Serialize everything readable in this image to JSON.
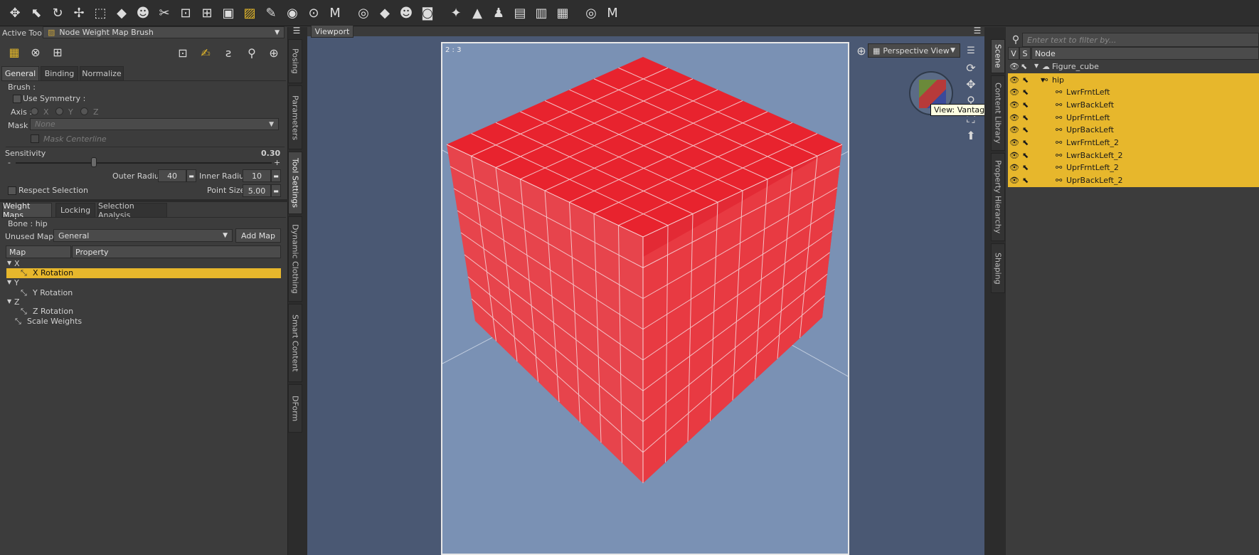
{
  "toolbar": {
    "icons": [
      "move-universal-icon",
      "pointer-icon",
      "rotate-icon",
      "translate-icon",
      "scale-icon",
      "geometry-brush-icon",
      "figure-tool-icon",
      "joint-editor-icon",
      "region-nav-icon",
      "spotlight-icon",
      "surface-selection-icon",
      "node-weight-brush-icon",
      "geometry-editor-icon",
      "node-selection-icon",
      "camera-icon",
      "morph-icon",
      "render-icon",
      "geometry-icon",
      "figure-icon",
      "camera2-icon",
      "light-icon",
      "scene-icon",
      "figure-pose-icon",
      "render-settings-icon",
      "render-settings2-icon",
      "render-settings3-icon",
      "render-icon2",
      "morph2-icon"
    ]
  },
  "left": {
    "active_tool_label": "Active Tool :",
    "active_tool_value": "Node Weight Map Brush",
    "tabs": [
      "General",
      "Binding",
      "Normalize"
    ],
    "brush_label": "Brush :",
    "use_symmetry": "Use Symmetry :",
    "axis_label": "Axis :",
    "axis_options": [
      "X",
      "Y",
      "Z"
    ],
    "mask_label": "Mask :",
    "mask_value": "None",
    "mask_centerline": "Mask Centerline",
    "sensitivity_label": "Sensitivity",
    "sensitivity_value": "0.30",
    "sensitivity_fraction": 0.3,
    "minus": "-",
    "plus": "+",
    "outer_radius_label": "Outer Radius :",
    "outer_radius_value": "40",
    "inner_radius_label": "Inner Radius :",
    "inner_radius_value": "10",
    "respect_selection": "Respect Selection",
    "point_size_label": "Point Size :",
    "point_size_value": "5.00",
    "tabs2": [
      "Weight Maps",
      "Locking",
      "Selection Analysis"
    ],
    "bone_label": "Bone : hip",
    "unused_maps_label": "Unused Maps :",
    "unused_maps_value": "General",
    "add_map": "Add Map",
    "col_map": "Map",
    "col_property": "Property",
    "tree": [
      {
        "group": "X",
        "item": "X Rotation",
        "selected": true
      },
      {
        "group": "Y",
        "item": "Y Rotation",
        "selected": false
      },
      {
        "group": "Z",
        "item": "Z Rotation",
        "selected": false
      }
    ],
    "scale_weights": "Scale Weights"
  },
  "vtabs_left": [
    "Posing",
    "Parameters",
    "Tool Settings",
    "Dynamic Clothing",
    "Smart Content",
    "DForm"
  ],
  "viewport": {
    "tab": "Viewport",
    "ratio": "2 : 3",
    "view": "Perspective View",
    "tooltip": "View: Vantage (LMB) | Orbit (LMB + Drag)"
  },
  "vtabs_right": [
    "Scene",
    "Content Library",
    "Property Hierarchy",
    "Shaping"
  ],
  "scene": {
    "filter_placeholder": "Enter text to filter by...",
    "col_v": "V",
    "col_s": "S",
    "col_node": "Node",
    "root": "Figure_cube",
    "hip": "hip",
    "nodes": [
      "LwrFrntLeft",
      "LwrBackLeft",
      "UprFrntLeft",
      "UprBackLeft",
      "LwrFrntLeft_2",
      "LwrBackLeft_2",
      "UprFrntLeft_2",
      "UprBackLeft_2"
    ]
  },
  "colors": {
    "accent": "#e7b72c",
    "cube": "#e8232e",
    "viewport_bg": "#7a91b4"
  }
}
